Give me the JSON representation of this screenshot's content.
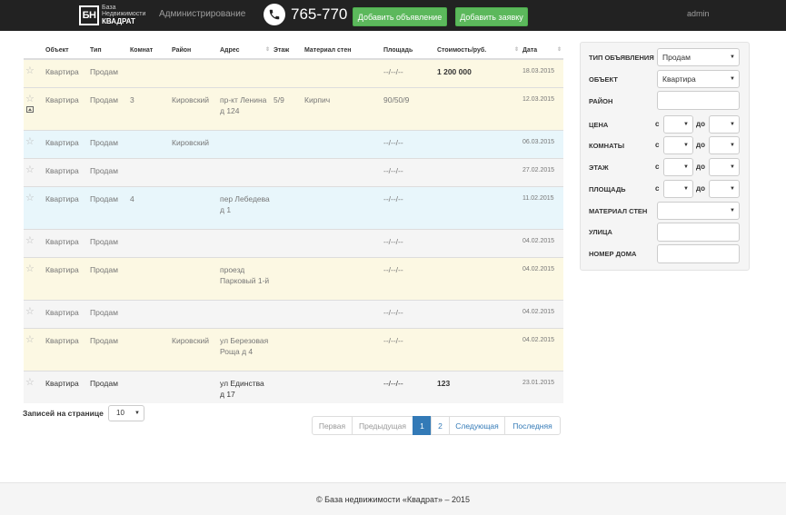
{
  "navbar": {
    "logo_abbr": "БН",
    "logo_line1": "База",
    "logo_line2": "Недвижимости",
    "logo_line3": "КВАДРАТ",
    "admin_link": "Администрирование",
    "phone": "765-770",
    "add_ad": "Добавить объявление",
    "add_request": "Добавить заявку",
    "user": "admin"
  },
  "table": {
    "headers": [
      "Объект",
      "Тип",
      "Комнат",
      "Район",
      "Адрес",
      "Этаж",
      "Материал стен",
      "Площадь",
      "Стоимость/руб.",
      "Дата"
    ],
    "rows": [
      {
        "object": "Квартира",
        "type": "Продам",
        "rooms": "",
        "district": "",
        "address": "",
        "floor": "",
        "material": "",
        "area": "--/--/--",
        "price": "1 200 000",
        "date": "18.03.2015"
      },
      {
        "object": "Квартира",
        "type": "Продам",
        "rooms": "3",
        "district": "Кировский",
        "address": "пр-кт Ленина д 124",
        "floor": "5/9",
        "material": "Кирпич",
        "area": "90/50/9",
        "price": "",
        "date": "12.03.2015"
      },
      {
        "object": "Квартира",
        "type": "Продам",
        "rooms": "",
        "district": "Кировский",
        "address": "",
        "floor": "",
        "material": "",
        "area": "--/--/--",
        "price": "",
        "date": "06.03.2015"
      },
      {
        "object": "Квартира",
        "type": "Продам",
        "rooms": "",
        "district": "",
        "address": "",
        "floor": "",
        "material": "",
        "area": "--/--/--",
        "price": "",
        "date": "27.02.2015"
      },
      {
        "object": "Квартира",
        "type": "Продам",
        "rooms": "4",
        "district": "",
        "address": "пер Лебедева д 1",
        "floor": "",
        "material": "",
        "area": "--/--/--",
        "price": "",
        "date": "11.02.2015"
      },
      {
        "object": "Квартира",
        "type": "Продам",
        "rooms": "",
        "district": "",
        "address": "",
        "floor": "",
        "material": "",
        "area": "--/--/--",
        "price": "",
        "date": "04.02.2015"
      },
      {
        "object": "Квартира",
        "type": "Продам",
        "rooms": "",
        "district": "",
        "address": "проезд Парковый 1-й",
        "floor": "",
        "material": "",
        "area": "--/--/--",
        "price": "",
        "date": "04.02.2015"
      },
      {
        "object": "Квартира",
        "type": "Продам",
        "rooms": "",
        "district": "",
        "address": "",
        "floor": "",
        "material": "",
        "area": "--/--/--",
        "price": "",
        "date": "04.02.2015"
      },
      {
        "object": "Квартира",
        "type": "Продам",
        "rooms": "",
        "district": "Кировский",
        "address": "ул Березовая Роща д 4",
        "floor": "",
        "material": "",
        "area": "--/--/--",
        "price": "",
        "date": "04.02.2015"
      },
      {
        "object": "Квартира",
        "type": "Продам",
        "rooms": "",
        "district": "",
        "address": "ул Единства д 17",
        "floor": "",
        "material": "",
        "area": "--/--/--",
        "price": "123",
        "date": "23.01.2015"
      }
    ]
  },
  "perpage": {
    "label": "Записей на странице",
    "value": "10"
  },
  "pagination": {
    "first": "Первая",
    "prev": "Предыдущая",
    "p1": "1",
    "p2": "2",
    "next": "Следующая",
    "last": "Последняя"
  },
  "filter": {
    "type_label": "ТИП ОБЪЯВЛЕНИЯ",
    "type_value": "Продам",
    "object_label": "ОБЪЕКТ",
    "object_value": "Квартира",
    "district_label": "РАЙОН",
    "price_label": "ЦЕНА",
    "rooms_label": "КОМНАТЫ",
    "floor_label": "ЭТАЖ",
    "area_label": "ПЛОЩАДЬ",
    "material_label": "МАТЕРИАЛ СТЕН",
    "street_label": "УЛИЦА",
    "house_label": "НОМЕР ДОМА",
    "from": "с",
    "to": "до"
  },
  "footer": {
    "text": "© База недвижимости «Квадрат» – 2015"
  },
  "colors": {
    "navbar": "#222222",
    "green": "#5cb85c",
    "blue": "#337ab7",
    "yellow_row": "#fcf8e3",
    "blue_row": "#e8f6fb"
  }
}
